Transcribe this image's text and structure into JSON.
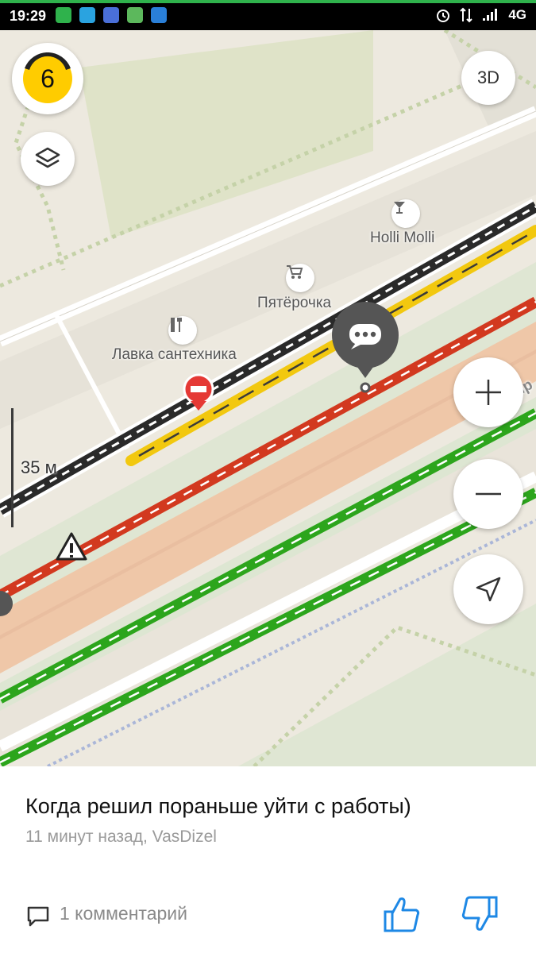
{
  "status_bar": {
    "time": "19:29",
    "network": "4G",
    "colors": {
      "background": "#000000",
      "accent_line": "#2fb24c"
    }
  },
  "map": {
    "traffic_score": "6",
    "view_toggle_label": "3D",
    "scale_label": "35 м",
    "pois": [
      {
        "name": "Holli Molli",
        "icon": "cocktail-icon"
      },
      {
        "name": "Пятёрочка",
        "icon": "shopping-cart-icon"
      },
      {
        "name": "Лавка сантехника",
        "icon": "tools-icon"
      }
    ],
    "street_label": "пр",
    "colors": {
      "traffic_red": "#d2391f",
      "traffic_yellow": "#f2c80f",
      "traffic_green": "#2ca51c",
      "road_black": "#2a2a2a",
      "score_yellow": "#ffcc00"
    }
  },
  "controls": {
    "layers_icon": "layers-icon",
    "zoom_in_icon": "plus-icon",
    "zoom_out_icon": "minus-icon",
    "locate_icon": "navigation-arrow-icon"
  },
  "post": {
    "text": "Когда решил пораньше уйти с работы)",
    "meta": "11 минут назад, VasDizel",
    "comments_label": "1 комментарий"
  }
}
